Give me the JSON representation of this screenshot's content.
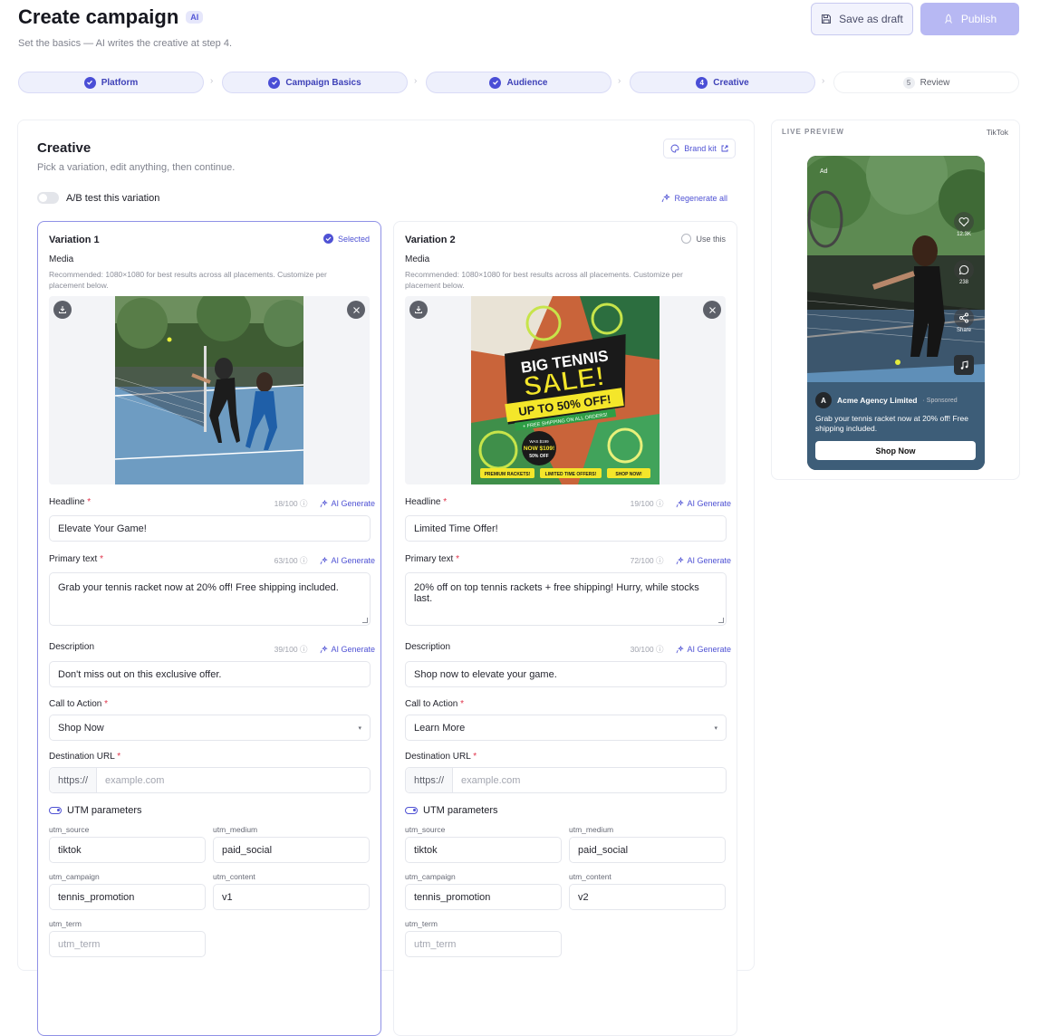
{
  "header": {
    "title": "Create campaign",
    "ai_badge": "AI",
    "subtitle": "Set the basics — AI writes the creative at step 4.",
    "save_draft_label": "Save as draft",
    "publish_label": "Publish"
  },
  "steps": [
    {
      "num": "",
      "label": "Platform",
      "state": "done"
    },
    {
      "num": "",
      "label": "Campaign Basics",
      "state": "done"
    },
    {
      "num": "",
      "label": "Audience",
      "state": "done"
    },
    {
      "num": "4",
      "label": "Creative",
      "state": "current"
    },
    {
      "num": "5",
      "label": "Review",
      "state": "pending"
    }
  ],
  "creative": {
    "title": "Creative",
    "subtitle": "Pick a variation, edit anything, then continue.",
    "brand_kit_label": "Brand kit",
    "ab_test_label": "A/B test this variation",
    "regenerate_label": "Regenerate all"
  },
  "labels": {
    "media": "Media",
    "media_hint": "Recommended: 1080×1080 for best results across all placements. Customize per placement below.",
    "headline": "Headline",
    "primary_text": "Primary text",
    "description": "Description",
    "cta": "Call to Action",
    "destination_url": "Destination URL",
    "ai_generate": "AI Generate",
    "url_prefix": "https://",
    "url_placeholder": "example.com",
    "utm_parameters": "UTM parameters",
    "utm_source": "utm_source",
    "utm_medium": "utm_medium",
    "utm_campaign": "utm_campaign",
    "utm_content": "utm_content",
    "utm_term": "utm_term",
    "required_mark": "*"
  },
  "variations": [
    {
      "title": "Variation 1",
      "status": "Selected",
      "headline": "Elevate Your Game!",
      "headline_count": "18/100",
      "primary_text": "Grab your tennis racket now at 20% off! Free shipping included.",
      "primary_count": "63/100",
      "description": "Don't miss out on this exclusive offer.",
      "description_count": "39/100",
      "cta": "Shop Now",
      "utm_source": "tiktok",
      "utm_medium": "paid_social",
      "utm_campaign": "tennis_promotion",
      "utm_content": "v1",
      "utm_term_placeholder": "utm_term"
    },
    {
      "title": "Variation 2",
      "status": "Use this",
      "headline": "Limited Time Offer!",
      "headline_count": "19/100",
      "primary_text": "20% off on top tennis rackets + free shipping! Hurry, while stocks last.",
      "primary_count": "72/100",
      "description": "Shop now to elevate your game.",
      "description_count": "30/100",
      "cta": "Learn More",
      "utm_source": "tiktok",
      "utm_medium": "paid_social",
      "utm_campaign": "tennis_promotion",
      "utm_content": "v2",
      "utm_term_placeholder": "utm_term"
    }
  ],
  "ad_image": {
    "line1": "BIG TENNIS",
    "line2": "SALE!",
    "line3": "UP TO 50% OFF!",
    "line4": "+ FREE SHIPPING ON ALL ORDERS!",
    "sticker_line1": "WAS $199",
    "sticker_line2": "NOW $109!",
    "sticker_line3": "50% OFF",
    "tag1": "PREMIUM RACKETS!",
    "tag2": "LIMITED TIME OFFERS!",
    "tag3": "SHOP NOW!"
  },
  "preview": {
    "label": "LIVE PREVIEW",
    "platform": "TikTok",
    "ad_tag": "Ad",
    "likes": "12.3K",
    "comments": "238",
    "share": "Share",
    "account_initial": "A",
    "account": "Acme Agency Limited",
    "sponsored": "· Sponsored",
    "copy": "Grab your tennis racket now at 20% off! Free shipping included.",
    "cta": "Shop Now"
  },
  "colors": {
    "accent": "#4f52d4",
    "publish_disabled": "#b7b8f3",
    "required": "#e0334a"
  }
}
